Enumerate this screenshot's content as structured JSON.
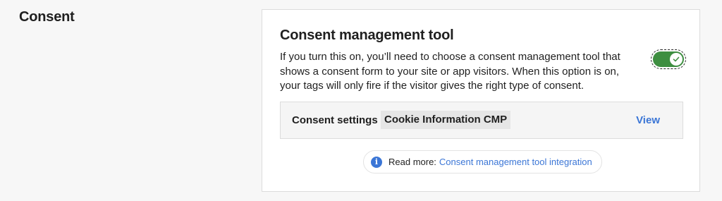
{
  "section": {
    "title": "Consent"
  },
  "card": {
    "title": "Consent management tool",
    "description": "If you turn this on, you’ll need to choose a consent management tool that shows a consent form to your site or app visitors. When this option is on, your tags will only fire if the visitor gives the right type of consent.",
    "toggle": {
      "state": "on",
      "icon": "check-icon"
    },
    "settings": {
      "label": "Consent settings",
      "value": "Cookie Information CMP",
      "action": "View"
    },
    "info": {
      "icon": "info-icon",
      "prefix": "Read more:",
      "link": "Consent management tool integration"
    }
  },
  "colors": {
    "accent": "#3b76d6",
    "toggle_on": "#3e8e41",
    "background": "#f7f7f7"
  }
}
